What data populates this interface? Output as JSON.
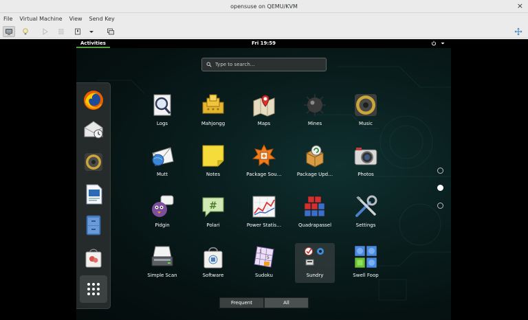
{
  "window": {
    "title": "opensuse on QEMU/KVM",
    "close_glyph": "×"
  },
  "menu": [
    "File",
    "Virtual Machine",
    "View",
    "Send Key"
  ],
  "toolbar": {
    "icons": [
      "console-view-icon",
      "details-lightbulb-icon",
      "run-icon",
      "pause-icon",
      "shutdown-icon",
      "shutdown-menu-icon",
      "snapshots-icon",
      "fullscreen-icon"
    ]
  },
  "topbar": {
    "activities": "Activities",
    "clock": "Fri 19:59"
  },
  "search": {
    "placeholder": "Type to search…"
  },
  "dash": [
    "firefox-icon",
    "evolution-mail-icon",
    "rhythmbox-speaker-icon",
    "writer-document-icon",
    "file-cabinet-icon",
    "software-bag-icon",
    "show-applications-icon"
  ],
  "apps": [
    {
      "label": "Logs",
      "icon": "logs-icon"
    },
    {
      "label": "Mahjongg",
      "icon": "mahjongg-icon"
    },
    {
      "label": "Maps",
      "icon": "maps-icon"
    },
    {
      "label": "Mines",
      "icon": "mines-icon"
    },
    {
      "label": "Music",
      "icon": "music-icon"
    },
    {
      "label": "Mutt",
      "icon": "mutt-icon"
    },
    {
      "label": "Notes",
      "icon": "notes-icon"
    },
    {
      "label": "Package Sou…",
      "icon": "package-sources-icon"
    },
    {
      "label": "Package Upd…",
      "icon": "package-updater-icon"
    },
    {
      "label": "Photos",
      "icon": "photos-camera-icon"
    },
    {
      "label": "Pidgin",
      "icon": "pidgin-icon"
    },
    {
      "label": "Polari",
      "icon": "polari-icon"
    },
    {
      "label": "Power Statis…",
      "icon": "power-statistics-icon"
    },
    {
      "label": "Quadrapassel",
      "icon": "quadrapassel-icon"
    },
    {
      "label": "Settings",
      "icon": "settings-tools-icon"
    },
    {
      "label": "Simple Scan",
      "icon": "scanner-icon"
    },
    {
      "label": "Software",
      "icon": "software-bag-icon"
    },
    {
      "label": "Sudoku",
      "icon": "sudoku-icon"
    },
    {
      "label": "Sundry",
      "icon": "sundry-folder-icon"
    },
    {
      "label": "Swell Foop",
      "icon": "swell-foop-icon"
    }
  ],
  "selected_app": "Sundry",
  "view_tabs": {
    "frequent": "Frequent",
    "all": "All"
  },
  "pager": {
    "pages": 3,
    "current": 2
  },
  "colors": {
    "accent": "#5a9d3f",
    "desktop": "#0a1f1f",
    "chrome": "#ebebeb"
  }
}
